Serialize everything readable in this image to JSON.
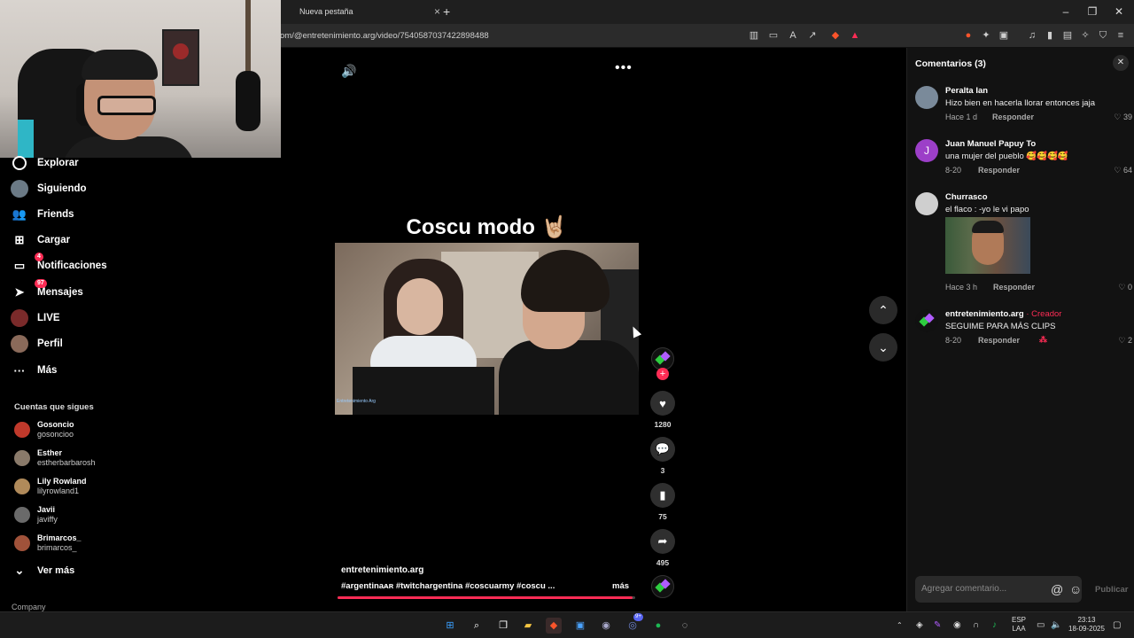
{
  "browser": {
    "tab_title": "Nueva pestaña",
    "tab_close": "×",
    "new_tab": "+",
    "url": "om/@entretenimiento.arg/video/7540587037422898488",
    "window_controls": [
      "–",
      "❐",
      "✕"
    ]
  },
  "sidebar": {
    "items": [
      {
        "label": "Explorar",
        "icon": "compass-icon"
      },
      {
        "label": "Siguiendo",
        "icon": "avatar-icon"
      },
      {
        "label": "Friends",
        "icon": "friends-icon"
      },
      {
        "label": "Cargar",
        "icon": "upload-icon"
      },
      {
        "label": "Notificaciones",
        "icon": "inbox-icon",
        "badge": "4"
      },
      {
        "label": "Mensajes",
        "icon": "send-icon",
        "badge": "97"
      },
      {
        "label": "LIVE",
        "icon": "live-icon"
      },
      {
        "label": "Perfil",
        "icon": "profile-icon"
      },
      {
        "label": "Más",
        "icon": "more-icon"
      }
    ],
    "following_title": "Cuentas que sigues",
    "following": [
      {
        "name": "Gosoncio",
        "handle": "gosoncioo",
        "color": "#c0392b"
      },
      {
        "name": "Esther",
        "handle": "estherbarbarosh",
        "color": "#8a7a6a"
      },
      {
        "name": "Lily Rowland",
        "handle": "lilyrowland1",
        "color": "#b08a5a"
      },
      {
        "name": "Javii",
        "handle": "javiffy",
        "color": "#6a6a6a"
      },
      {
        "name": "Brimarcos_",
        "handle": "brimarcos_",
        "color": "#a0523a"
      }
    ],
    "see_more": "Ver más",
    "company": "Company"
  },
  "video": {
    "title": "Coscu modo 🤘🏼",
    "watermark": "Entretenimiento Arg",
    "author": "entretenimiento.arg",
    "hashtags": "#argentinaᴀʀ #twitchargentina #coscuarmy #coscu ...",
    "more": "más",
    "progress_fraction": 0.99,
    "likes": "1280",
    "comments": "3",
    "saves": "75",
    "shares": "495"
  },
  "comments_panel": {
    "title": "Comentarios (3)",
    "input_placeholder": "Agregar comentario...",
    "publish": "Publicar",
    "reply_label": "Responder",
    "items": [
      {
        "name": "Peralta Ian",
        "text": "Hizo bien en hacerla llorar entonces jaja",
        "time": "Hace 1 d",
        "likes": "39",
        "avatar_color": "#7a8a9a"
      },
      {
        "name": "Juan Manuel Papuy To",
        "text": "una mujer del pueblo 🥰🥰🥰🥰",
        "time": "8-20",
        "likes": "64",
        "avatar_color": "#9c3fc8",
        "initial": "J"
      },
      {
        "name": "Churrasco",
        "text": "el flaco : -yo le vi papo",
        "time": "Hace 3 h",
        "likes": "0",
        "avatar_color": "#cfcfcf"
      },
      {
        "name": "entretenimiento.arg",
        "creator_tag": "· Creador",
        "text": "SEGUIME PARA MÁS CLIPS",
        "time": "8-20",
        "likes": "2",
        "avatar_color": "#111111"
      }
    ]
  },
  "taskbar": {
    "lang": "ESP",
    "lang2": "LAA",
    "time": "23:13",
    "date": "18-09-2025",
    "discord_badge": "9+"
  },
  "colors": {
    "accent": "#fe2c55",
    "panel": "#121212"
  }
}
